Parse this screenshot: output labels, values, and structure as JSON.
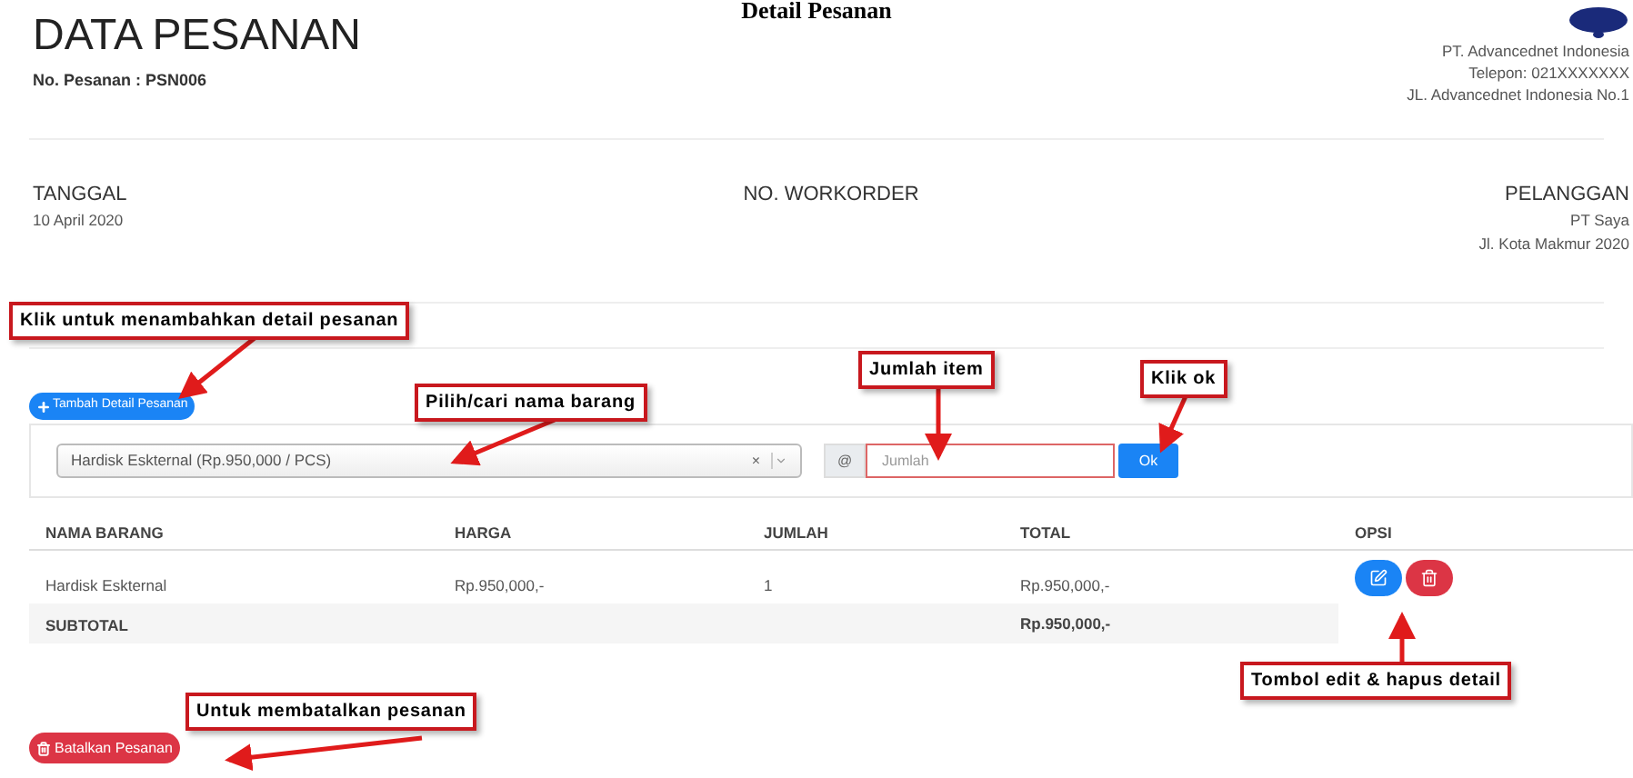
{
  "header_title": "Detail Pesanan",
  "page_title": "DATA PESANAN",
  "order_number": "No. Pesanan : PSN006",
  "company_lines": [
    "PT. Advancednet Indonesia",
    "Telepon: 021XXXXXXX",
    "JL. Advancednet Indonesia No.1"
  ],
  "info": [
    {
      "label": "TANGGAL",
      "lines": [
        "10 April 2020"
      ]
    },
    {
      "label": "NO. WORKORDER"
    },
    {
      "label": "PELANGGAN",
      "lines": [
        "PT Saya",
        "Jl. Kota Makmur 2020"
      ]
    }
  ],
  "add_button": "Tambah Detail Pesanan",
  "item_form": {
    "select_value": "Hardisk Eskternal (Rp.950,000 / PCS)",
    "clear": "×",
    "addon": "@",
    "quantity_placeholder": "Jumlah",
    "ok_button": "Ok"
  },
  "table": {
    "columns": [
      "NAMA BARANG",
      "HARGA",
      "JUMLAH",
      "TOTAL",
      "OPSI"
    ],
    "rows": [
      {
        "cells": [
          "Hardisk Eskternal",
          "Rp.950,000,-",
          "1",
          "Rp.950,000,-"
        ]
      }
    ],
    "subtotal": {
      "label": "SUBTOTAL",
      "total": "Rp.950,000,-"
    }
  },
  "cancel_button": "Batalkan Pesanan",
  "annotations": [
    {
      "text": "Klik untuk menambahkan detail pesanan"
    },
    {
      "text": "Pilih/cari nama barang"
    },
    {
      "text": "Jumlah item"
    },
    {
      "text": "Klik ok"
    },
    {
      "text": "Tombol edit & hapus detail"
    },
    {
      "text": "Untuk membatalkan pesanan"
    }
  ]
}
